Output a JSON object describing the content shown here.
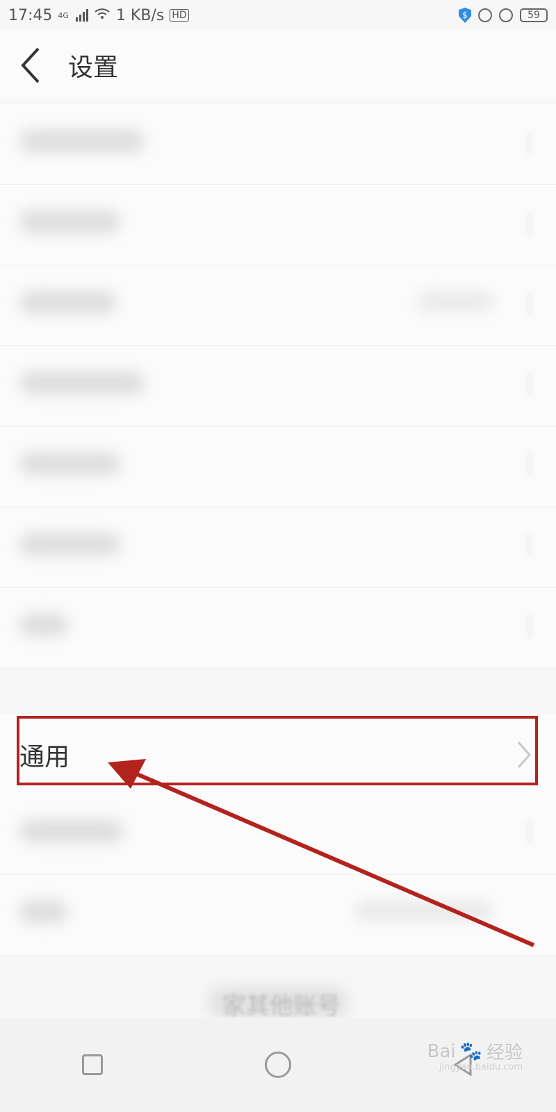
{
  "status": {
    "time": "17:45",
    "network": "4G",
    "speed": "1 KB/s",
    "hd": "HD",
    "battery": "59"
  },
  "header": {
    "title": "设置"
  },
  "general": {
    "label": "通用"
  },
  "bottom_text": "家其他账号",
  "watermark": {
    "brand": "Bai",
    "sub": "经验",
    "url": "jingyan.baidu.com"
  },
  "colors": {
    "annotation": "#b3231e",
    "accent_shield": "#2f8de4"
  }
}
